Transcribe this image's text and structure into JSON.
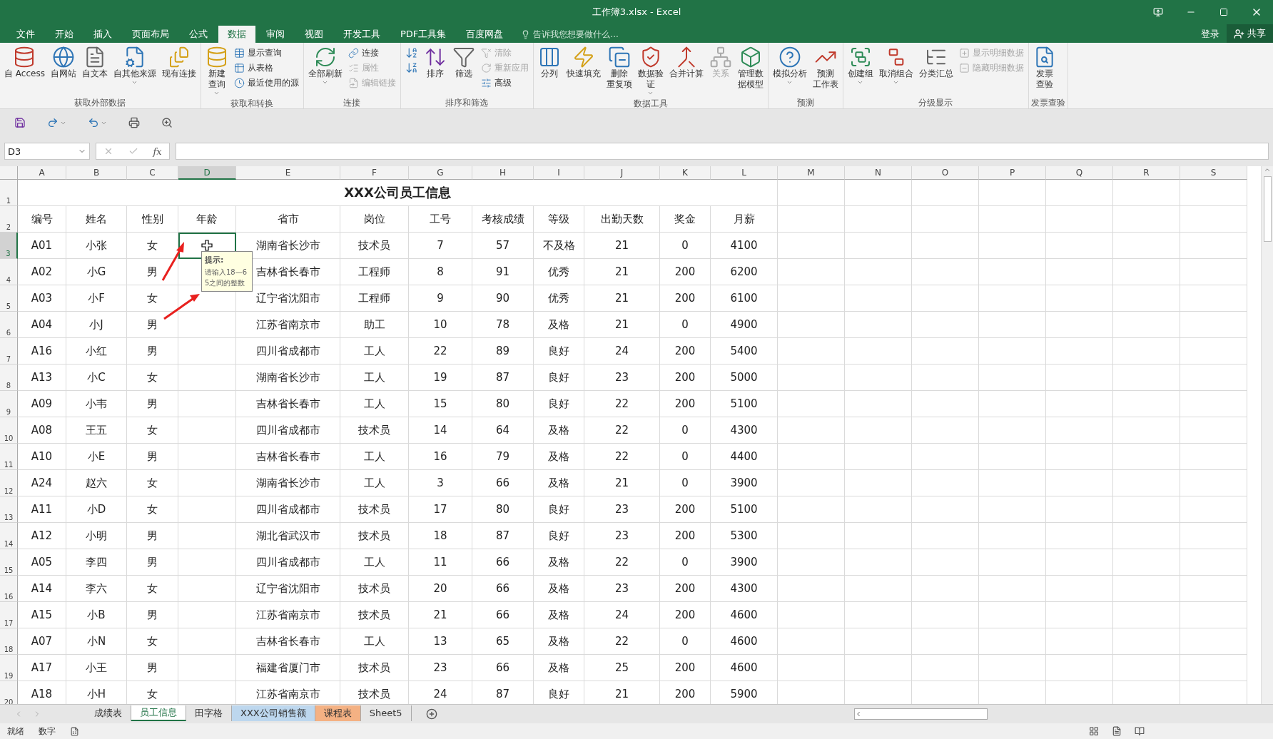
{
  "window": {
    "title": "工作簿3.xlsx - Excel"
  },
  "menu_tabs": [
    {
      "label": "文件",
      "selected": false
    },
    {
      "label": "开始",
      "selected": false
    },
    {
      "label": "插入",
      "selected": false
    },
    {
      "label": "页面布局",
      "selected": false
    },
    {
      "label": "公式",
      "selected": false
    },
    {
      "label": "数据",
      "selected": true
    },
    {
      "label": "审阅",
      "selected": false
    },
    {
      "label": "视图",
      "selected": false
    },
    {
      "label": "开发工具",
      "selected": false
    },
    {
      "label": "PDF工具集",
      "selected": false
    },
    {
      "label": "百度网盘",
      "selected": false
    }
  ],
  "tell_me": {
    "placeholder": "告诉我您想要做什么..."
  },
  "account": {
    "sign_in": "登录",
    "share": "共享"
  },
  "ribbon_groups": [
    {
      "label": "获取外部数据",
      "items": [
        {
          "kind": "large",
          "label": [
            "自 Access"
          ],
          "has_menu": false,
          "disabled": false
        },
        {
          "kind": "large",
          "label": [
            "自网站"
          ],
          "has_menu": false,
          "disabled": false
        },
        {
          "kind": "large",
          "label": [
            "自文本"
          ],
          "has_menu": false,
          "disabled": false
        },
        {
          "kind": "large",
          "label": [
            "自其他来源"
          ],
          "has_menu": true,
          "disabled": false
        },
        {
          "kind": "large",
          "label": [
            "现有连接"
          ],
          "has_menu": false,
          "disabled": false
        }
      ]
    },
    {
      "label": "获取和转换",
      "items": [
        {
          "kind": "large",
          "label": [
            "新建",
            "查询"
          ],
          "has_menu": true,
          "disabled": false
        },
        {
          "kind": "small",
          "label": [
            "显示查询"
          ],
          "disabled": false
        },
        {
          "kind": "small",
          "label": [
            "从表格"
          ],
          "disabled": false
        },
        {
          "kind": "small",
          "label": [
            "最近使用的源"
          ],
          "disabled": false
        }
      ]
    },
    {
      "label": "连接",
      "items": [
        {
          "kind": "large",
          "label": [
            "全部刷新"
          ],
          "has_menu": true,
          "disabled": false
        },
        {
          "kind": "small",
          "label": [
            "连接"
          ],
          "disabled": false
        },
        {
          "kind": "small",
          "label": [
            "属性"
          ],
          "disabled": true
        },
        {
          "kind": "small",
          "label": [
            "编辑链接"
          ],
          "disabled": true
        }
      ]
    },
    {
      "label": "排序和筛选",
      "items": [
        {
          "kind": "ascending",
          "disabled": false
        },
        {
          "kind": "descending",
          "disabled": false
        },
        {
          "kind": "large",
          "label": [
            "排序"
          ],
          "has_menu": false,
          "disabled": false
        },
        {
          "kind": "large",
          "label": [
            "筛选"
          ],
          "has_menu": false,
          "disabled": false
        },
        {
          "kind": "small",
          "label": [
            "清除"
          ],
          "disabled": true
        },
        {
          "kind": "small",
          "label": [
            "重新应用"
          ],
          "disabled": true
        },
        {
          "kind": "small",
          "label": [
            "高级"
          ],
          "disabled": false
        }
      ]
    },
    {
      "label": "数据工具",
      "items": [
        {
          "kind": "large",
          "label": [
            "分列"
          ],
          "has_menu": false,
          "disabled": false
        },
        {
          "kind": "large",
          "label": [
            "快速填充"
          ],
          "has_menu": false,
          "disabled": false
        },
        {
          "kind": "large",
          "label": [
            "删除",
            "重复项"
          ],
          "has_menu": false,
          "disabled": false
        },
        {
          "kind": "large",
          "label": [
            "数据验",
            "证"
          ],
          "has_menu": true,
          "disabled": false
        },
        {
          "kind": "large",
          "label": [
            "合并计算"
          ],
          "has_menu": false,
          "disabled": false
        },
        {
          "kind": "large",
          "label": [
            "关系"
          ],
          "has_menu": false,
          "disabled": true
        },
        {
          "kind": "large",
          "label": [
            "管理数",
            "据模型"
          ],
          "has_menu": false,
          "disabled": false
        }
      ]
    },
    {
      "label": "预测",
      "items": [
        {
          "kind": "large",
          "label": [
            "模拟分析"
          ],
          "has_menu": true,
          "disabled": false
        },
        {
          "kind": "large",
          "label": [
            "预测",
            "工作表"
          ],
          "has_menu": false,
          "disabled": false
        }
      ]
    },
    {
      "label": "分级显示",
      "items": [
        {
          "kind": "large",
          "label": [
            "创建组"
          ],
          "has_menu": true,
          "disabled": false
        },
        {
          "kind": "large",
          "label": [
            "取消组合"
          ],
          "has_menu": true,
          "disabled": false
        },
        {
          "kind": "large",
          "label": [
            "分类汇总"
          ],
          "has_menu": false,
          "disabled": false
        },
        {
          "kind": "small",
          "label": [
            "显示明细数据"
          ],
          "disabled": true
        },
        {
          "kind": "small",
          "label": [
            "隐藏明细数据"
          ],
          "disabled": true
        }
      ]
    },
    {
      "label": "发票查验",
      "items": [
        {
          "kind": "large",
          "label": [
            "发票",
            "查验"
          ],
          "has_menu": false,
          "disabled": false
        }
      ]
    }
  ],
  "formula_bar": {
    "name_box": "D3",
    "function_label": "fx"
  },
  "sheet": {
    "columns": [
      {
        "label": "A",
        "selected": false
      },
      {
        "label": "B",
        "selected": false
      },
      {
        "label": "C",
        "selected": false
      },
      {
        "label": "D",
        "selected": true
      },
      {
        "label": "E",
        "selected": false
      },
      {
        "label": "F",
        "selected": false
      },
      {
        "label": "G",
        "selected": false
      },
      {
        "label": "H",
        "selected": false
      },
      {
        "label": "I",
        "selected": false
      },
      {
        "label": "J",
        "selected": false
      },
      {
        "label": "K",
        "selected": false
      },
      {
        "label": "L",
        "selected": false
      },
      {
        "label": "M",
        "selected": false
      },
      {
        "label": "N",
        "selected": false
      },
      {
        "label": "O",
        "selected": false
      },
      {
        "label": "P",
        "selected": false
      },
      {
        "label": "Q",
        "selected": false
      },
      {
        "label": "R",
        "selected": false
      },
      {
        "label": "S",
        "selected": false
      }
    ],
    "title": "XXX公司员工信息",
    "header": [
      "编号",
      "姓名",
      "性别",
      "年龄",
      "省市",
      "岗位",
      "工号",
      "考核成绩",
      "等级",
      "出勤天数",
      "奖金",
      "月薪"
    ],
    "rows": [
      {
        "number": "3",
        "selected": true,
        "cells": [
          "A01",
          "小张",
          "女",
          "",
          "湖南省长沙市",
          "技术员",
          "7",
          "57",
          "不及格",
          "21",
          "0",
          "4100"
        ]
      },
      {
        "number": "4",
        "selected": false,
        "cells": [
          "A02",
          "小G",
          "男",
          "",
          "吉林省长春市",
          "工程师",
          "8",
          "91",
          "优秀",
          "21",
          "200",
          "6200"
        ]
      },
      {
        "number": "5",
        "selected": false,
        "cells": [
          "A03",
          "小F",
          "女",
          "",
          "辽宁省沈阳市",
          "工程师",
          "9",
          "90",
          "优秀",
          "21",
          "200",
          "6100"
        ]
      },
      {
        "number": "6",
        "selected": false,
        "cells": [
          "A04",
          "小J",
          "男",
          "",
          "江苏省南京市",
          "助工",
          "10",
          "78",
          "及格",
          "21",
          "0",
          "4900"
        ]
      },
      {
        "number": "7",
        "selected": false,
        "cells": [
          "A16",
          "小红",
          "男",
          "",
          "四川省成都市",
          "工人",
          "22",
          "89",
          "良好",
          "24",
          "200",
          "5400"
        ]
      },
      {
        "number": "8",
        "selected": false,
        "cells": [
          "A13",
          "小C",
          "女",
          "",
          "湖南省长沙市",
          "工人",
          "19",
          "87",
          "良好",
          "23",
          "200",
          "5000"
        ]
      },
      {
        "number": "9",
        "selected": false,
        "cells": [
          "A09",
          "小韦",
          "男",
          "",
          "吉林省长春市",
          "工人",
          "15",
          "80",
          "良好",
          "22",
          "200",
          "5100"
        ]
      },
      {
        "number": "10",
        "selected": false,
        "cells": [
          "A08",
          "王五",
          "女",
          "",
          "四川省成都市",
          "技术员",
          "14",
          "64",
          "及格",
          "22",
          "0",
          "4300"
        ]
      },
      {
        "number": "11",
        "selected": false,
        "cells": [
          "A10",
          "小E",
          "男",
          "",
          "吉林省长春市",
          "工人",
          "16",
          "79",
          "及格",
          "22",
          "0",
          "4400"
        ]
      },
      {
        "number": "12",
        "selected": false,
        "cells": [
          "A24",
          "赵六",
          "女",
          "",
          "湖南省长沙市",
          "工人",
          "3",
          "66",
          "及格",
          "21",
          "0",
          "3900"
        ]
      },
      {
        "number": "13",
        "selected": false,
        "cells": [
          "A11",
          "小D",
          "女",
          "",
          "四川省成都市",
          "技术员",
          "17",
          "80",
          "良好",
          "23",
          "200",
          "5100"
        ]
      },
      {
        "number": "14",
        "selected": false,
        "cells": [
          "A12",
          "小明",
          "男",
          "",
          "湖北省武汉市",
          "技术员",
          "18",
          "87",
          "良好",
          "23",
          "200",
          "5300"
        ]
      },
      {
        "number": "15",
        "selected": false,
        "cells": [
          "A05",
          "李四",
          "男",
          "",
          "四川省成都市",
          "工人",
          "11",
          "66",
          "及格",
          "22",
          "0",
          "3900"
        ]
      },
      {
        "number": "16",
        "selected": false,
        "cells": [
          "A14",
          "李六",
          "女",
          "",
          "辽宁省沈阳市",
          "技术员",
          "20",
          "66",
          "及格",
          "23",
          "200",
          "4300"
        ]
      },
      {
        "number": "17",
        "selected": false,
        "cells": [
          "A15",
          "小B",
          "男",
          "",
          "江苏省南京市",
          "技术员",
          "21",
          "66",
          "及格",
          "24",
          "200",
          "4600"
        ]
      },
      {
        "number": "18",
        "selected": false,
        "cells": [
          "A07",
          "小N",
          "女",
          "",
          "吉林省长春市",
          "工人",
          "13",
          "65",
          "及格",
          "22",
          "0",
          "4600"
        ]
      },
      {
        "number": "19",
        "selected": false,
        "cells": [
          "A17",
          "小王",
          "男",
          "",
          "福建省厦门市",
          "技术员",
          "23",
          "66",
          "及格",
          "25",
          "200",
          "4600"
        ]
      },
      {
        "number": "20",
        "selected": false,
        "cells": [
          "A18",
          "小H",
          "女",
          "",
          "江苏省南京市",
          "技术员",
          "24",
          "87",
          "良好",
          "21",
          "200",
          "5900"
        ]
      }
    ],
    "title_row_number": "1",
    "header_row_number": "2",
    "tooltip": {
      "title": "提示:",
      "message": "请输入18—65之间的整数"
    }
  },
  "sheet_tabs": [
    {
      "label": "成绩表",
      "selected": false
    },
    {
      "label": "员工信息",
      "selected": true
    },
    {
      "label": "田字格",
      "selected": false
    },
    {
      "label": "XXX公司销售额",
      "selected": false,
      "color": "#bdd7ee"
    },
    {
      "label": "课程表",
      "selected": false,
      "color": "#f4b183"
    },
    {
      "label": "Sheet5",
      "selected": false
    }
  ],
  "status_bar": {
    "mode": "就绪",
    "num": "数字"
  }
}
